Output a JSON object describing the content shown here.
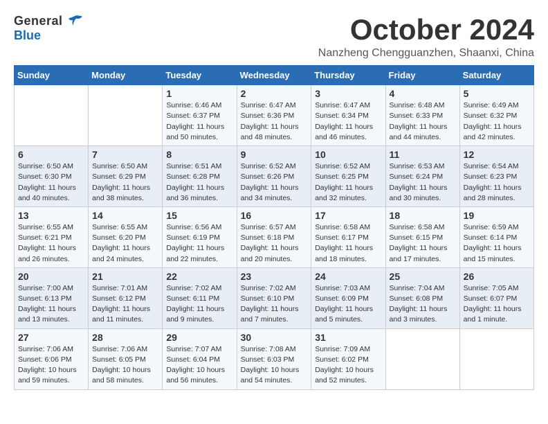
{
  "header": {
    "logo_general": "General",
    "logo_blue": "Blue",
    "month_title": "October 2024",
    "location": "Nanzheng Chengguanzhen, Shaanxi, China"
  },
  "weekdays": [
    "Sunday",
    "Monday",
    "Tuesday",
    "Wednesday",
    "Thursday",
    "Friday",
    "Saturday"
  ],
  "weeks": [
    [
      {
        "day": "",
        "info": ""
      },
      {
        "day": "",
        "info": ""
      },
      {
        "day": "1",
        "info": "Sunrise: 6:46 AM\nSunset: 6:37 PM\nDaylight: 11 hours and 50 minutes."
      },
      {
        "day": "2",
        "info": "Sunrise: 6:47 AM\nSunset: 6:36 PM\nDaylight: 11 hours and 48 minutes."
      },
      {
        "day": "3",
        "info": "Sunrise: 6:47 AM\nSunset: 6:34 PM\nDaylight: 11 hours and 46 minutes."
      },
      {
        "day": "4",
        "info": "Sunrise: 6:48 AM\nSunset: 6:33 PM\nDaylight: 11 hours and 44 minutes."
      },
      {
        "day": "5",
        "info": "Sunrise: 6:49 AM\nSunset: 6:32 PM\nDaylight: 11 hours and 42 minutes."
      }
    ],
    [
      {
        "day": "6",
        "info": "Sunrise: 6:50 AM\nSunset: 6:30 PM\nDaylight: 11 hours and 40 minutes."
      },
      {
        "day": "7",
        "info": "Sunrise: 6:50 AM\nSunset: 6:29 PM\nDaylight: 11 hours and 38 minutes."
      },
      {
        "day": "8",
        "info": "Sunrise: 6:51 AM\nSunset: 6:28 PM\nDaylight: 11 hours and 36 minutes."
      },
      {
        "day": "9",
        "info": "Sunrise: 6:52 AM\nSunset: 6:26 PM\nDaylight: 11 hours and 34 minutes."
      },
      {
        "day": "10",
        "info": "Sunrise: 6:52 AM\nSunset: 6:25 PM\nDaylight: 11 hours and 32 minutes."
      },
      {
        "day": "11",
        "info": "Sunrise: 6:53 AM\nSunset: 6:24 PM\nDaylight: 11 hours and 30 minutes."
      },
      {
        "day": "12",
        "info": "Sunrise: 6:54 AM\nSunset: 6:23 PM\nDaylight: 11 hours and 28 minutes."
      }
    ],
    [
      {
        "day": "13",
        "info": "Sunrise: 6:55 AM\nSunset: 6:21 PM\nDaylight: 11 hours and 26 minutes."
      },
      {
        "day": "14",
        "info": "Sunrise: 6:55 AM\nSunset: 6:20 PM\nDaylight: 11 hours and 24 minutes."
      },
      {
        "day": "15",
        "info": "Sunrise: 6:56 AM\nSunset: 6:19 PM\nDaylight: 11 hours and 22 minutes."
      },
      {
        "day": "16",
        "info": "Sunrise: 6:57 AM\nSunset: 6:18 PM\nDaylight: 11 hours and 20 minutes."
      },
      {
        "day": "17",
        "info": "Sunrise: 6:58 AM\nSunset: 6:17 PM\nDaylight: 11 hours and 18 minutes."
      },
      {
        "day": "18",
        "info": "Sunrise: 6:58 AM\nSunset: 6:15 PM\nDaylight: 11 hours and 17 minutes."
      },
      {
        "day": "19",
        "info": "Sunrise: 6:59 AM\nSunset: 6:14 PM\nDaylight: 11 hours and 15 minutes."
      }
    ],
    [
      {
        "day": "20",
        "info": "Sunrise: 7:00 AM\nSunset: 6:13 PM\nDaylight: 11 hours and 13 minutes."
      },
      {
        "day": "21",
        "info": "Sunrise: 7:01 AM\nSunset: 6:12 PM\nDaylight: 11 hours and 11 minutes."
      },
      {
        "day": "22",
        "info": "Sunrise: 7:02 AM\nSunset: 6:11 PM\nDaylight: 11 hours and 9 minutes."
      },
      {
        "day": "23",
        "info": "Sunrise: 7:02 AM\nSunset: 6:10 PM\nDaylight: 11 hours and 7 minutes."
      },
      {
        "day": "24",
        "info": "Sunrise: 7:03 AM\nSunset: 6:09 PM\nDaylight: 11 hours and 5 minutes."
      },
      {
        "day": "25",
        "info": "Sunrise: 7:04 AM\nSunset: 6:08 PM\nDaylight: 11 hours and 3 minutes."
      },
      {
        "day": "26",
        "info": "Sunrise: 7:05 AM\nSunset: 6:07 PM\nDaylight: 11 hours and 1 minute."
      }
    ],
    [
      {
        "day": "27",
        "info": "Sunrise: 7:06 AM\nSunset: 6:06 PM\nDaylight: 10 hours and 59 minutes."
      },
      {
        "day": "28",
        "info": "Sunrise: 7:06 AM\nSunset: 6:05 PM\nDaylight: 10 hours and 58 minutes."
      },
      {
        "day": "29",
        "info": "Sunrise: 7:07 AM\nSunset: 6:04 PM\nDaylight: 10 hours and 56 minutes."
      },
      {
        "day": "30",
        "info": "Sunrise: 7:08 AM\nSunset: 6:03 PM\nDaylight: 10 hours and 54 minutes."
      },
      {
        "day": "31",
        "info": "Sunrise: 7:09 AM\nSunset: 6:02 PM\nDaylight: 10 hours and 52 minutes."
      },
      {
        "day": "",
        "info": ""
      },
      {
        "day": "",
        "info": ""
      }
    ]
  ]
}
